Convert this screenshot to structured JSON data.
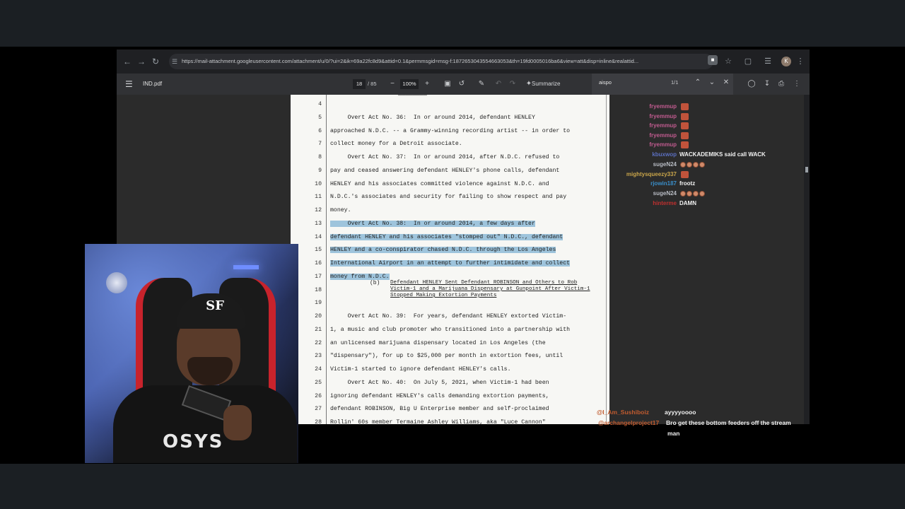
{
  "browser": {
    "url": "https://mail-attachment.googleusercontent.com/attachment/u/0/?ui=2&ik=69a22fc8d9&attid=0.1&permmsgid=msg-f:1872653043554663053&th=19fd0005016ba6&view=att&disp=inline&realattid...",
    "avatar_letter": "K"
  },
  "pdf": {
    "filename": "IND.pdf",
    "current_page": "18",
    "total_pages": "/ 85",
    "zoom": "100%",
    "summarize_label": "Summarize",
    "find_query": "aispo",
    "find_count": "1/1",
    "top_fragment": "————————",
    "lines": [
      {
        "n": "4",
        "t": ""
      },
      {
        "n": "5",
        "t": "     Overt Act No. 36:  In or around 2014, defendant HENLEY"
      },
      {
        "n": "6",
        "t": "approached N.D.C. -- a Grammy-winning recording artist -- in order to"
      },
      {
        "n": "7",
        "t": "collect money for a Detroit associate."
      },
      {
        "n": "8",
        "t": "     Overt Act No. 37:  In or around 2014, after N.D.C. refused to"
      },
      {
        "n": "9",
        "t": "pay and ceased answering defendant HENLEY's phone calls, defendant"
      },
      {
        "n": "10",
        "t": "HENLEY and his associates committed violence against N.D.C. and"
      },
      {
        "n": "11",
        "t": "N.D.C.'s associates and security for failing to show respect and pay"
      },
      {
        "n": "12",
        "t": "money."
      },
      {
        "n": "13",
        "t": "     Overt Act No. 38:  In or around 2014, a few days after"
      },
      {
        "n": "14",
        "t": "defendant HENLEY and his associates \"stomped out\" N.D.C., defendant"
      },
      {
        "n": "15",
        "t": "HENLEY and a co-conspirator chased N.D.C. through the Los Angeles"
      },
      {
        "n": "16",
        "t": "International Airport in an attempt to further intimidate and collect"
      },
      {
        "n": "17",
        "t": "money from N.D.C."
      },
      {
        "n": "18",
        "t": ""
      },
      {
        "n": "19",
        "t": ""
      },
      {
        "n": "20",
        "t": "     Overt Act No. 39:  For years, defendant HENLEY extorted Victim-"
      },
      {
        "n": "21",
        "t": "1, a music and club promoter who transitioned into a partnership with"
      },
      {
        "n": "22",
        "t": "an unlicensed marijuana dispensary located in Los Angeles (the"
      },
      {
        "n": "23",
        "t": "\"dispensary\"), for up to $25,000 per month in extortion fees, until"
      },
      {
        "n": "24",
        "t": "Victim-1 started to ignore defendant HENLEY's calls."
      },
      {
        "n": "25",
        "t": "     Overt Act No. 40:  On July 5, 2021, when Victim-1 had been"
      },
      {
        "n": "26",
        "t": "ignoring defendant HENLEY's calls demanding extortion payments,"
      },
      {
        "n": "27",
        "t": "defendant ROBINSON, Big U Enterprise member and self-proclaimed"
      },
      {
        "n": "28",
        "t": "Rollin' 60s member Termaine Ashley Williams, aka \"Luce Cannon\""
      }
    ],
    "subheading_marker": "(b)",
    "subheading": "Defendant HENLEY Sent Defendant ROBINSON and Others to Rob Victim-1 and a Marijuana Dispensary at Gunpoint After Victim-1 Stopped Making Extortion Payments",
    "highlight_color": "#9ec4dc"
  },
  "chat": {
    "messages": [
      {
        "user": "fryemmup",
        "color": "#c05b8f",
        "text": "",
        "emotes": "red"
      },
      {
        "user": "fryemmup",
        "color": "#c05b8f",
        "text": "",
        "emotes": "red"
      },
      {
        "user": "fryemmup",
        "color": "#c05b8f",
        "text": "",
        "emotes": "red"
      },
      {
        "user": "fryemmup",
        "color": "#c05b8f",
        "text": "",
        "emotes": "red"
      },
      {
        "user": "fryemmup",
        "color": "#c05b8f",
        "text": "",
        "emotes": "red"
      },
      {
        "user": "kbuxwop",
        "color": "#5b6fc0",
        "text": "WACKADEMIKS said call WACK",
        "emotes": ""
      },
      {
        "user": "sugeN24",
        "color": "#b8bcc4",
        "text": "",
        "emotes": "dots"
      },
      {
        "user": "mightysqueezy337",
        "color": "#c9a54a",
        "text": "",
        "emotes": "red1"
      },
      {
        "user": "rjowin187",
        "color": "#3a8ec9",
        "text": "frootz",
        "emotes": ""
      },
      {
        "user": "sugeN24",
        "color": "#b8bcc4",
        "text": "",
        "emotes": "dots"
      },
      {
        "user": "hinterme",
        "color": "#c0302f",
        "text": "DAMN",
        "emotes": ""
      }
    ],
    "overlay": [
      {
        "user": "@I_Am_Sushiboiz",
        "color": "#c05b2f",
        "text": "ayyyyoooo"
      },
      {
        "user": "@archangelproject17",
        "color": "#c05b2f",
        "text": "Bro get these bottom feeders off the stream"
      },
      {
        "user": "",
        "color": "#ffffff",
        "text": "man"
      }
    ]
  },
  "webcam": {
    "cap_logo": "SF",
    "shirt_text": "OSYS"
  }
}
